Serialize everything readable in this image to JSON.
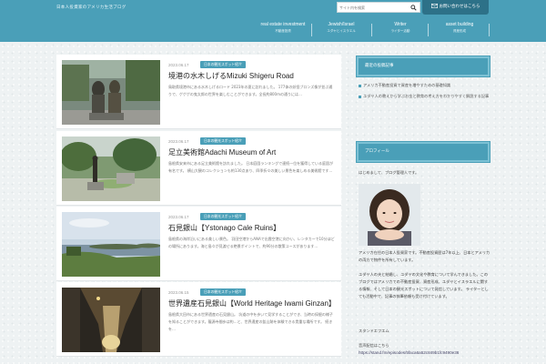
{
  "header": {
    "site_title": "日本人投資家のアメリカ生活ブログ",
    "search_placeholder": "サイト内を検索",
    "contact_label": "お問い合わせはこちら",
    "nav": [
      {
        "en": "real estate investment",
        "jp": "不動産投資"
      },
      {
        "en": "Jewish/Israel",
        "jp": "ユダヤとイスラエル"
      },
      {
        "en": "Writer",
        "jp": "ライター活動"
      },
      {
        "en": "asset building",
        "jp": "資産形成"
      }
    ]
  },
  "posts": [
    {
      "date": "2023.06.17",
      "category": "日本の観光スポット紹介",
      "title": "境港の水木しげるMizuki Shigeru Road",
      "excerpt": "鳥取県境港市にある水木しげるロード 2023年の夏に訪れました。 177体の妖怪ブロンズ像が並ぶ通りで、ゲゲゲの鬼太郎の世界を楽しむことができます。全長約800mの通りには…"
    },
    {
      "date": "2023.06.17",
      "category": "日本の観光スポット紹介",
      "title": "足立美術館Adachi Museum of Art",
      "excerpt": "島根県安来市にある足立美術館を訪れました。 日本庭園ランキングで連続一位を獲得している庭園が有名です。 横山大観のコレクションも約130点あり、四季折々の美しい景色を楽しめる美術館です…"
    },
    {
      "date": "2023.06.17",
      "category": "日本の観光スポット紹介",
      "title": "石見銀山【Ystonago Cale Ruins】",
      "excerpt": "島根県の海岸沿いにある美しい景色。 羽田空港からANAで出雲空港に向かい、レンタカーで10分ほどの場所にあります。海と島々が見渡せる絶景ポイントで、約90分の散策コースがあります…"
    },
    {
      "date": "2023.06.15",
      "category": "日本の観光スポット紹介",
      "title": "世界遺産石見銀山【World Heritage Iwami Ginzan】",
      "excerpt": "島根県大田市にある世界遺産の石見銀山。 坑道の中を歩いて見学することができ、当時の採掘の様子を知ることができます。龍源寺間歩は約…と、世界遺産の鉱山跡を体験できる貴重な場所です。 続きを…"
    }
  ],
  "sidebar": {
    "widget1_title": "最近の投稿記事",
    "widget1_items": [
      "アメリカ不動産投資で資産を増やすための基礎知識",
      "ユダヤ人の教えから学ぶお金と教育の考え方をわかりやすく解説する記事"
    ],
    "widget2_title": "プロフィール",
    "profile_intro": "はじめまして、ブログ管理人です。",
    "profile_p1": "アメリカ在住の日本人投資家です。不動産投資歴は7年以上、日本とアメリカの両方で物件を所有しています。",
    "profile_p2": "ユダヤ人の夫と結婚し、ユダヤの文化や教育について学んできました。このブログではアメリカでの不動産投資、資産形成、ユダヤとイスラエルに関する情報、そして日本の観光スポットについて発信しています。 ライターとしても活動中で、記事の執筆依頼も受け付けています。",
    "stand_label": "スタンドエフエム",
    "stand_sub": "音声配信はこちら",
    "stand_url": "https://stand.fm/episodes/5faca6a52c849b1fc9490e36"
  },
  "colors": {
    "header": "#4a9fb8",
    "accent_dark": "#2d7188",
    "category_badge": "#4a9fb8"
  }
}
